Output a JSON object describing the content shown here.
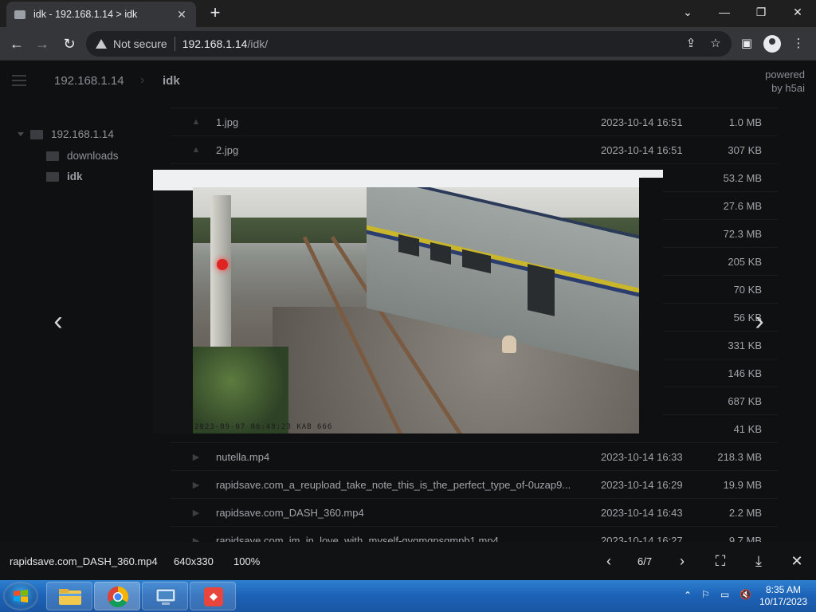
{
  "browser": {
    "tab_title": "idk - 192.168.1.14 > idk",
    "new_tab": "+",
    "not_secure": "Not secure",
    "url_host": "192.168.1.14",
    "url_path": "/idk/"
  },
  "h5ai": {
    "breadcrumb": [
      "192.168.1.14",
      "idk"
    ],
    "powered_by": [
      "powered",
      "by h5ai"
    ],
    "tree": [
      {
        "label": "192.168.1.14",
        "level": 0
      },
      {
        "label": "downloads",
        "level": 1
      },
      {
        "label": "idk",
        "level": 1
      }
    ],
    "files": [
      {
        "name": "1.jpg",
        "date": "2023-10-14 16:51",
        "size": "1.0 MB",
        "type": "image"
      },
      {
        "name": "2.jpg",
        "date": "2023-10-14 16:51",
        "size": "307 KB",
        "type": "image"
      },
      {
        "name": "",
        "date": "6:47",
        "size": "53.2 MB",
        "type": "video"
      },
      {
        "name": "",
        "date": "7:30",
        "size": "27.6 MB",
        "type": "video"
      },
      {
        "name": "",
        "date": "6:51",
        "size": "72.3 MB",
        "type": "video"
      },
      {
        "name": "",
        "date": "6:44",
        "size": "205 KB",
        "type": "video"
      },
      {
        "name": "",
        "date": "7:58",
        "size": "70 KB",
        "type": "video"
      },
      {
        "name": "",
        "date": "7:57",
        "size": "56 KB",
        "type": "video"
      },
      {
        "name": "",
        "date": "7:43",
        "size": "331 KB",
        "type": "video"
      },
      {
        "name": "",
        "date": "7:43",
        "size": "146 KB",
        "type": "video"
      },
      {
        "name": "",
        "date": "7:42",
        "size": "687 KB",
        "type": "video"
      },
      {
        "name": "",
        "date": "7:49",
        "size": "41 KB",
        "type": "video"
      },
      {
        "name": "nutella.mp4",
        "date": "2023-10-14 16:33",
        "size": "218.3 MB",
        "type": "video"
      },
      {
        "name": "rapidsave.com_a_reupload_take_note_this_is_the_perfect_type_of-0uzap9...",
        "date": "2023-10-14 16:29",
        "size": "19.9 MB",
        "type": "video"
      },
      {
        "name": "rapidsave.com_DASH_360.mp4",
        "date": "2023-10-14 16:43",
        "size": "2.2 MB",
        "type": "video"
      },
      {
        "name": "rapidsave.com_im_in_love_with_myself-gvqmqpsqmpb1.mp4",
        "date": "2023-10-14 16:27",
        "size": "9.7 MB",
        "type": "video"
      }
    ]
  },
  "viewer": {
    "filename": "rapidsave.com_DASH_360.mp4",
    "dimensions": "640x330",
    "zoom": "100%",
    "index": "6/7",
    "osd_timestamp": "2023-09-07 06:48:23 KAB 666"
  },
  "taskbar": {
    "time": "8:35 AM",
    "date": "10/17/2023"
  }
}
